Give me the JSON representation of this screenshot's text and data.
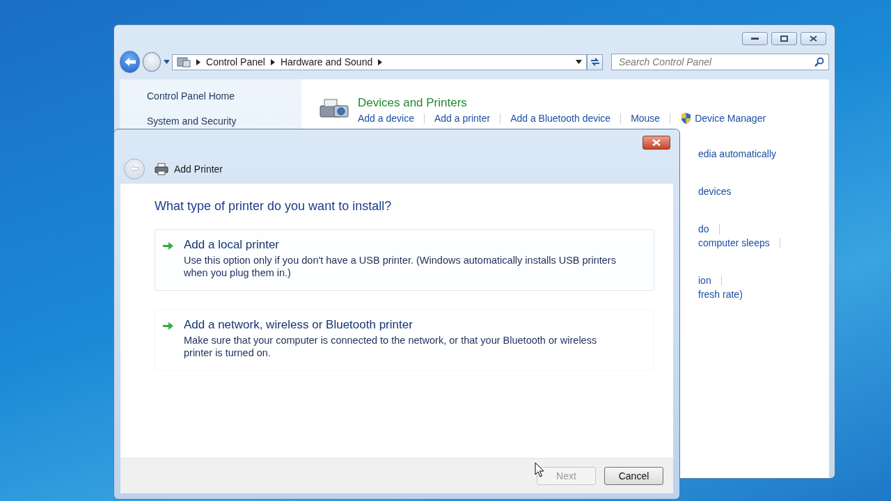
{
  "back_window": {
    "breadcrumb": [
      "Control Panel",
      "Hardware and Sound"
    ],
    "search": {
      "placeholder": "Search Control Panel"
    },
    "sidebar": {
      "items": [
        "Control Panel Home",
        "System and Security"
      ]
    },
    "section": {
      "title": "Devices and Printers",
      "links": [
        {
          "label": "Add a device",
          "kind": "plain"
        },
        {
          "label": "Add a printer",
          "kind": "plain"
        },
        {
          "label": "Add a Bluetooth device",
          "kind": "plain"
        },
        {
          "label": "Mouse",
          "kind": "plain"
        },
        {
          "label": "Device Manager",
          "kind": "admin"
        }
      ]
    },
    "partial_links": [
      [
        {
          "text": "edia automatically",
          "separator": false
        }
      ],
      [
        {
          "text": "devices",
          "separator": false
        }
      ],
      [
        {
          "text": "do",
          "separator": true
        },
        {
          "text": "computer sleeps",
          "separator": true
        }
      ],
      [
        {
          "text": "ion",
          "separator": true
        },
        {
          "text": "fresh rate)",
          "separator": false
        }
      ]
    ]
  },
  "dialog": {
    "title": "Add Printer",
    "heading": "What type of printer do you want to install?",
    "options": [
      {
        "title": "Add a local printer",
        "description": "Use this option only if you don't have a USB printer. (Windows automatically installs USB printers when you plug them in.)",
        "selected": true
      },
      {
        "title": "Add a network, wireless or Bluetooth printer",
        "description": "Make sure that your computer is connected to the network, or that your Bluetooth or wireless printer is turned on.",
        "selected": false
      }
    ],
    "buttons": [
      {
        "label": "Next",
        "disabled": true
      },
      {
        "label": "Cancel",
        "disabled": false
      }
    ]
  }
}
